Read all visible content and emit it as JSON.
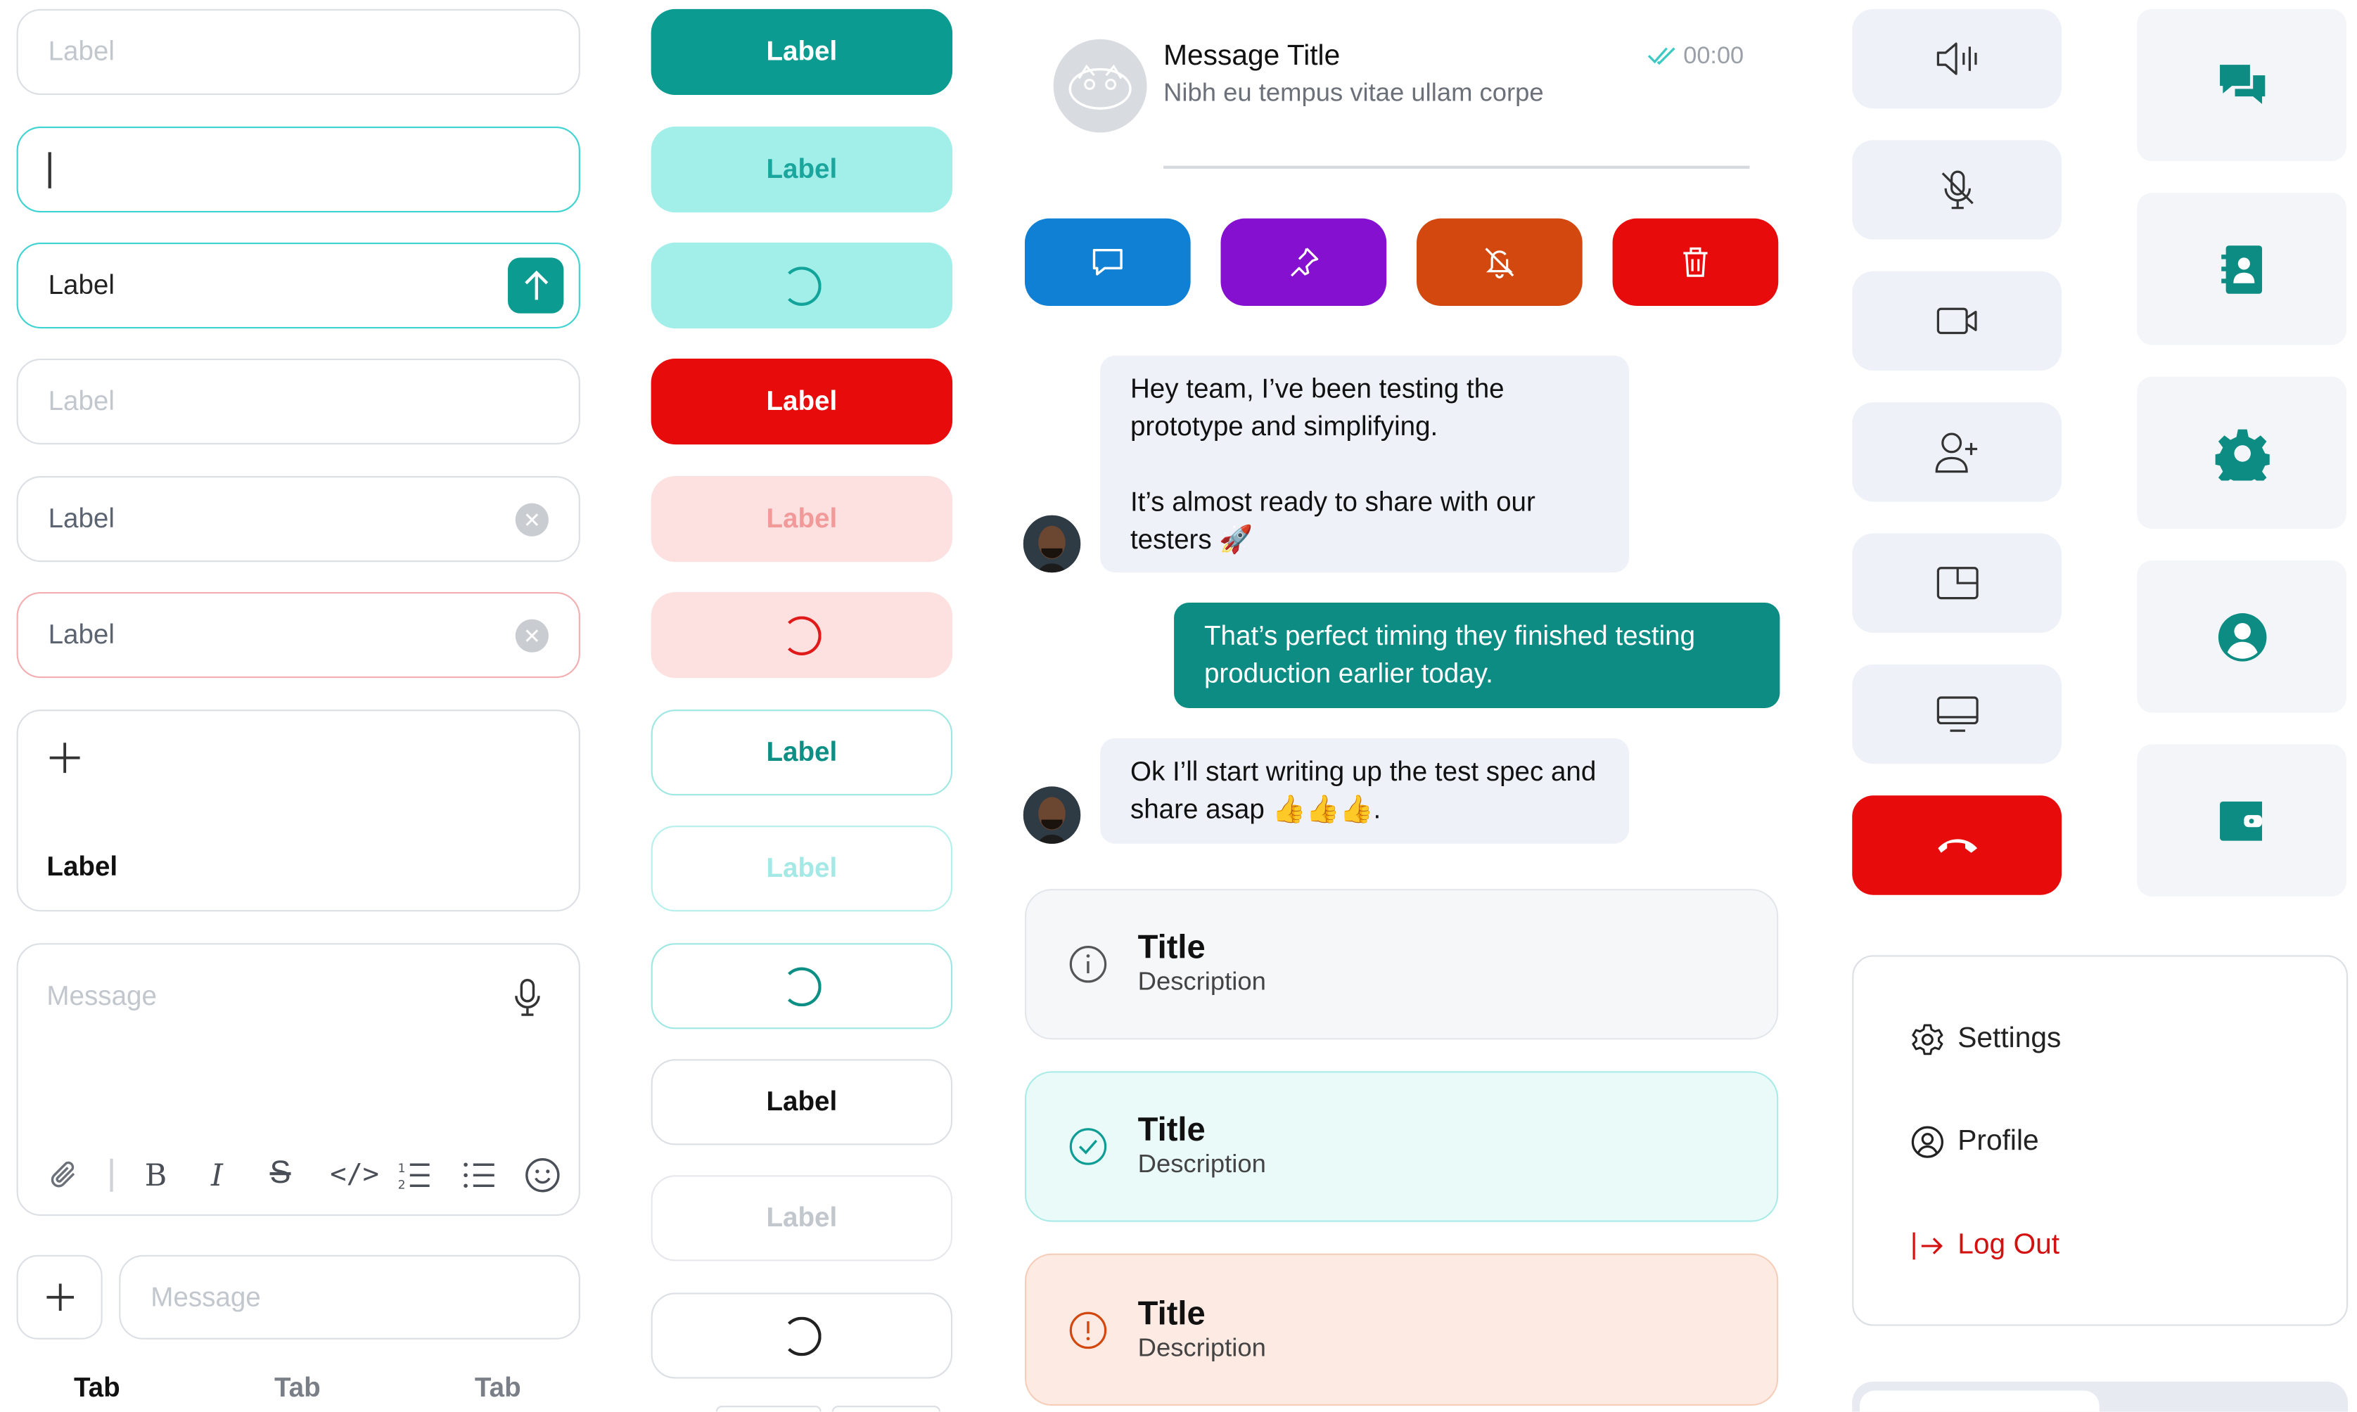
{
  "inputs": {
    "empty1": "Label",
    "filled_send": "Label",
    "empty2": "Label",
    "clear1": "Label",
    "clear_error": "Label",
    "upload_label": "Label",
    "composer_placeholder": "Message",
    "bottom_placeholder": "Message"
  },
  "tabs": [
    "Tab",
    "Tab",
    "Tab"
  ],
  "buttons": {
    "primary": "Label",
    "primary_light": "Label",
    "danger": "Label",
    "danger_light": "Label",
    "outline": "Label",
    "outline_disabled": "Label",
    "neutral": "Label",
    "neutral_disabled": "Label"
  },
  "message": {
    "title": "Message Title",
    "preview": "Nibh eu tempus vitae ullam corpe",
    "time": "00:00"
  },
  "chat": {
    "msg1a": "Hey team, I’ve been testing the prototype and simplifying.",
    "msg1b": "It’s almost ready to share with our testers 🚀",
    "msg2": "That’s perfect timing they finished testing production earlier today.",
    "msg3": "Ok I’ll start writing up the test spec and share asap 👍👍👍."
  },
  "alerts": [
    {
      "title": "Title",
      "description": "Description"
    },
    {
      "title": "Title",
      "description": "Description"
    },
    {
      "title": "Title",
      "description": "Description"
    }
  ],
  "menu": {
    "settings": "Settings",
    "profile": "Profile",
    "logout": "Log Out"
  },
  "colors": {
    "teal": "#0b9b91",
    "teal_light": "#a2efea",
    "red": "#e80b0b",
    "red_light": "#fde1e1",
    "blue": "#1080d4",
    "purple": "#8510cf",
    "orange": "#d3480f",
    "icon_bg": "#eef2f8",
    "chat_teal": "#0d8c83"
  },
  "icons": [
    "send-arrow-icon",
    "clear-icon",
    "plus-icon",
    "mic-icon",
    "paperclip-icon",
    "bold-icon",
    "italic-icon",
    "strikethrough-icon",
    "code-icon",
    "numbered-list-icon",
    "bullet-list-icon",
    "emoji-icon",
    "read-check-icon",
    "comment-icon",
    "pin-icon",
    "bell-off-icon",
    "trash-icon",
    "info-icon",
    "check-circle-icon",
    "alert-circle-icon",
    "speaker-icon",
    "mic-off-icon",
    "video-icon",
    "add-user-icon",
    "pip-icon",
    "screen-icon",
    "hang-up-icon",
    "chat-icon",
    "contact-book-icon",
    "gear-icon",
    "user-circle-icon",
    "wallet-icon",
    "logout-icon"
  ]
}
